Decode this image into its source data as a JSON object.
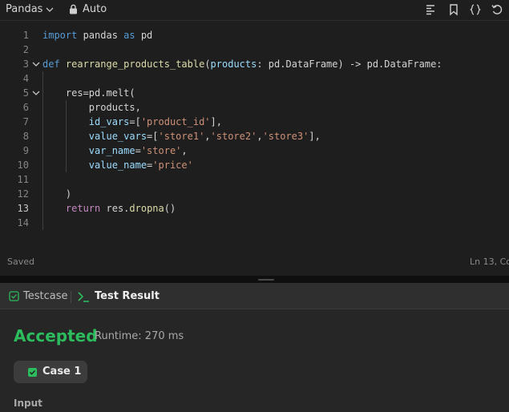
{
  "toolbar": {
    "language": "Pandas",
    "mode": "Auto"
  },
  "editor": {
    "lines": [
      {
        "num": "1",
        "tokens": [
          {
            "t": "import",
            "c": "kw"
          },
          {
            "t": " pandas ",
            "c": "plain"
          },
          {
            "t": "as",
            "c": "kw"
          },
          {
            "t": " pd",
            "c": "plain"
          }
        ]
      },
      {
        "num": "2",
        "tokens": []
      },
      {
        "num": "3",
        "tokens": [
          {
            "t": "def",
            "c": "kw"
          },
          {
            "t": " ",
            "c": "plain"
          },
          {
            "t": "rearrange_products_table",
            "c": "fn"
          },
          {
            "t": "(",
            "c": "plain"
          },
          {
            "t": "products",
            "c": "param"
          },
          {
            "t": ": pd.DataFrame) -> pd.DataFrame:",
            "c": "plain"
          }
        ]
      },
      {
        "num": "4",
        "tokens": []
      },
      {
        "num": "5",
        "tokens": [
          {
            "t": "    res=pd.melt(",
            "c": "plain"
          }
        ]
      },
      {
        "num": "6",
        "tokens": [
          {
            "t": "        products,",
            "c": "plain"
          }
        ]
      },
      {
        "num": "7",
        "tokens": [
          {
            "t": "        ",
            "c": "plain"
          },
          {
            "t": "id_vars",
            "c": "param"
          },
          {
            "t": "=[",
            "c": "plain"
          },
          {
            "t": "'product_id'",
            "c": "str"
          },
          {
            "t": "],",
            "c": "plain"
          }
        ]
      },
      {
        "num": "8",
        "tokens": [
          {
            "t": "        ",
            "c": "plain"
          },
          {
            "t": "value_vars",
            "c": "param"
          },
          {
            "t": "=[",
            "c": "plain"
          },
          {
            "t": "'store1'",
            "c": "str"
          },
          {
            "t": ",",
            "c": "plain"
          },
          {
            "t": "'store2'",
            "c": "str"
          },
          {
            "t": ",",
            "c": "plain"
          },
          {
            "t": "'store3'",
            "c": "str"
          },
          {
            "t": "],",
            "c": "plain"
          }
        ]
      },
      {
        "num": "9",
        "tokens": [
          {
            "t": "        ",
            "c": "plain"
          },
          {
            "t": "var_name",
            "c": "param"
          },
          {
            "t": "=",
            "c": "plain"
          },
          {
            "t": "'store'",
            "c": "str"
          },
          {
            "t": ",",
            "c": "plain"
          }
        ]
      },
      {
        "num": "10",
        "tokens": [
          {
            "t": "        ",
            "c": "plain"
          },
          {
            "t": "value_name",
            "c": "param"
          },
          {
            "t": "=",
            "c": "plain"
          },
          {
            "t": "'price'",
            "c": "str"
          }
        ]
      },
      {
        "num": "11",
        "tokens": []
      },
      {
        "num": "12",
        "tokens": [
          {
            "t": "    )",
            "c": "plain"
          }
        ]
      },
      {
        "num": "13",
        "tokens": [
          {
            "t": "    ",
            "c": "plain"
          },
          {
            "t": "return",
            "c": "ctl"
          },
          {
            "t": " res.",
            "c": "plain"
          },
          {
            "t": "dropna",
            "c": "fn"
          },
          {
            "t": "()",
            "c": "plain"
          }
        ]
      },
      {
        "num": "14",
        "tokens": []
      }
    ],
    "active_line": "13",
    "status_saved": "Saved",
    "cursor_position": "Ln 13, Co"
  },
  "result_panel": {
    "tab_testcase": "Testcase",
    "tab_test_result": "Test Result",
    "status": "Accepted",
    "runtime": "Runtime: 270 ms",
    "case_label": "Case 1",
    "input_label": "Input"
  },
  "colors": {
    "accepted": "#2cbb5d",
    "editor_bg": "#1e1e1e",
    "keyword": "#569cd6",
    "string": "#ce9178"
  },
  "icons": [
    "chevron-down-icon",
    "lock-icon",
    "format-icon",
    "bookmark-icon",
    "braces-icon",
    "reset-icon",
    "fold-chevron-icon",
    "checkbox-icon",
    "terminal-icon"
  ]
}
